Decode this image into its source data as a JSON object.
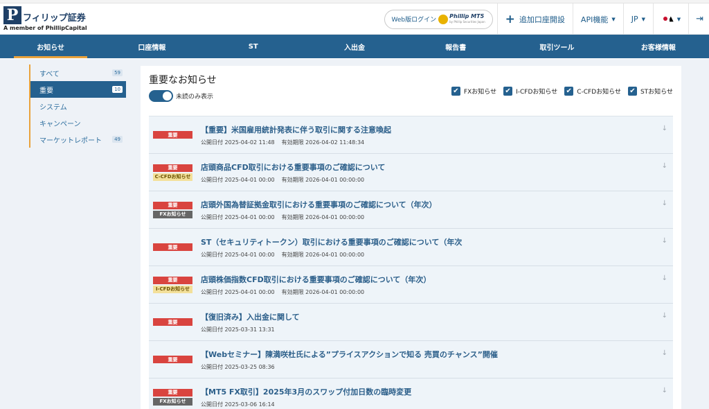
{
  "logo": {
    "mark": "P",
    "name": "フィリップ証券",
    "sub": "A member of PhillipCapital"
  },
  "header": {
    "web_login": "Web版ログイン",
    "mt5_label": "Phillip MT5",
    "mt5_small": "by Phillip Securities Japan",
    "add_account": "追加口座開設",
    "api": "API機能",
    "lang": "JP"
  },
  "nav": [
    "お知らせ",
    "口座情報",
    "ST",
    "入出金",
    "報告書",
    "取引ツール",
    "お客様情報"
  ],
  "sidebar": [
    {
      "label": "すべて",
      "count": "59"
    },
    {
      "label": "重要",
      "count": "10"
    },
    {
      "label": "システム",
      "count": ""
    },
    {
      "label": "キャンペーン",
      "count": ""
    },
    {
      "label": "マーケットレポート",
      "count": "49"
    }
  ],
  "panel": {
    "title": "重要なお知らせ",
    "toggle_label": "未読のみ表示",
    "filters": [
      "FXお知らせ",
      "I-CFDお知らせ",
      "C-CFDお知らせ",
      "STお知らせ"
    ]
  },
  "notices": [
    {
      "badges": [
        "重要"
      ],
      "title": "【重要】米国雇用統計発表に伴う取引に関する注意喚起",
      "published": "公開日付 2025-04-02 11:48",
      "expiry": "有効期限 2026-04-02 11:48:34"
    },
    {
      "badges": [
        "重要",
        "C-CFDお知らせ"
      ],
      "title": "店頭商品CFD取引における重要事項のご確認について",
      "published": "公開日付 2025-04-01 00:00",
      "expiry": "有効期限 2026-04-01 00:00:00"
    },
    {
      "badges": [
        "重要",
        "FXお知らせ"
      ],
      "title": "店頭外国為替証拠金取引における重要事項のご確認について（年次）",
      "published": "公開日付 2025-04-01 00:00",
      "expiry": "有効期限 2026-04-01 00:00:00"
    },
    {
      "badges": [
        "重要"
      ],
      "title": "ST（セキュリティトークン）取引における重要事項のご確認について（年次",
      "published": "公開日付 2025-04-01 00:00",
      "expiry": "有効期限 2026-04-01 00:00:00"
    },
    {
      "badges": [
        "重要",
        "I-CFDお知らせ"
      ],
      "title": "店頭株価指数CFD取引における重要事項のご確認について（年次）",
      "published": "公開日付 2025-04-01 00:00",
      "expiry": "有効期限 2026-04-01 00:00:00"
    },
    {
      "badges": [
        "重要"
      ],
      "title": "【復旧済み】入出金に関して",
      "published": "公開日付 2025-03-31 13:31",
      "expiry": ""
    },
    {
      "badges": [
        "重要"
      ],
      "title": "【Webセミナー】陳満咲杜氏による”プライスアクションで知る 売買のチャンス”開催",
      "published": "公開日付 2025-03-25 08:36",
      "expiry": ""
    },
    {
      "badges": [
        "重要",
        "FXお知らせ"
      ],
      "title": "【MT5 FX取引】2025年3月のスワップ付加日数の臨時変更",
      "published": "公開日付 2025-03-06 16:14",
      "expiry": ""
    }
  ]
}
